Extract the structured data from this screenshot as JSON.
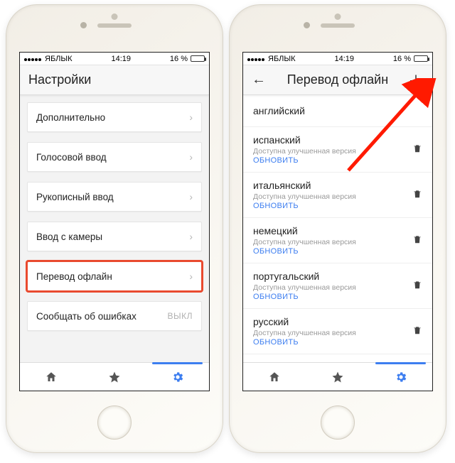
{
  "status": {
    "carrier": "ЯБЛЫК",
    "time": "14:19",
    "battery_pct": "16 %"
  },
  "left": {
    "title": "Настройки",
    "items": [
      {
        "label": "Дополнительно"
      },
      {
        "label": "Голосовой ввод"
      },
      {
        "label": "Рукописный ввод"
      },
      {
        "label": "Ввод с камеры"
      },
      {
        "label": "Перевод офлайн",
        "highlight": true
      },
      {
        "label": "Сообщать об ошибках",
        "badge": "ВЫКЛ"
      }
    ]
  },
  "right": {
    "title": "Перевод офлайн",
    "langs": [
      {
        "name": "английский"
      },
      {
        "name": "испанский",
        "sub": "Доступна улучшенная версия",
        "link": "ОБНОВИТЬ",
        "trash": true
      },
      {
        "name": "итальянский",
        "sub": "Доступна улучшенная версия",
        "link": "ОБНОВИТЬ",
        "trash": true
      },
      {
        "name": "немецкий",
        "sub": "Доступна улучшенная версия",
        "link": "ОБНОВИТЬ",
        "trash": true
      },
      {
        "name": "португальский",
        "sub": "Доступна улучшенная версия",
        "link": "ОБНОВИТЬ",
        "trash": true
      },
      {
        "name": "русский",
        "sub": "Доступна улучшенная версия",
        "link": "ОБНОВИТЬ",
        "trash": true
      }
    ]
  },
  "nav": {
    "home": "home-icon",
    "star": "star-icon",
    "gear": "gear-icon"
  }
}
